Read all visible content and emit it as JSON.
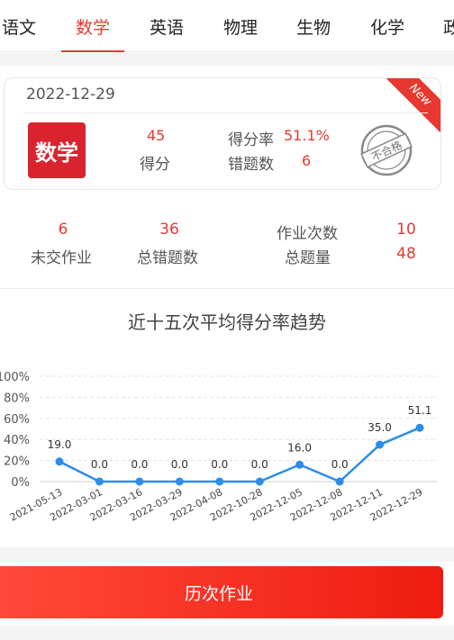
{
  "tabs": [
    {
      "label": "语文",
      "active": false
    },
    {
      "label": "数学",
      "active": true
    },
    {
      "label": "英语",
      "active": false
    },
    {
      "label": "物理",
      "active": false
    },
    {
      "label": "生物",
      "active": false
    },
    {
      "label": "化学",
      "active": false
    },
    {
      "label": "政",
      "active": false
    }
  ],
  "card": {
    "date": "2022-12-29",
    "badge": "New",
    "subject": "数学",
    "score_value": "45",
    "score_label": "得分",
    "rate_label": "得分率",
    "rate_value": "51.1%",
    "wrong_label": "错题数",
    "wrong_value": "6",
    "stamp": "不合格"
  },
  "summary": {
    "unsubmitted_value": "6",
    "unsubmitted_label": "未交作业",
    "total_wrong_value": "36",
    "total_wrong_label": "总错题数",
    "homework_count_label": "作业次数",
    "homework_count_value": "10",
    "total_questions_label": "总题量",
    "total_questions_value": "48"
  },
  "chart_title": "近十五次平均得分率趋势",
  "chart_data": {
    "type": "line",
    "title": "近十五次平均得分率趋势",
    "categories": [
      "2021-05-13",
      "2022-03-01",
      "2022-03-16",
      "2022-03-29",
      "2022-04-08",
      "2022-10-28",
      "2022-12-05",
      "2022-12-08",
      "2022-12-11",
      "2022-12-29"
    ],
    "values": [
      19.0,
      0.0,
      0.0,
      0.0,
      0.0,
      0.0,
      16.0,
      0.0,
      35.0,
      51.1
    ],
    "value_labels": [
      "19.0",
      "0.0",
      "0.0",
      "0.0",
      "0.0",
      "0.0",
      "16.0",
      "0.0",
      "35.0",
      "51.1"
    ],
    "yticks": [
      "0%",
      "20%",
      "40%",
      "60%",
      "80%",
      "100%"
    ],
    "ylim": [
      0,
      100
    ],
    "grid": true,
    "color": "#2b8ee8"
  },
  "history_button": "历次作业"
}
